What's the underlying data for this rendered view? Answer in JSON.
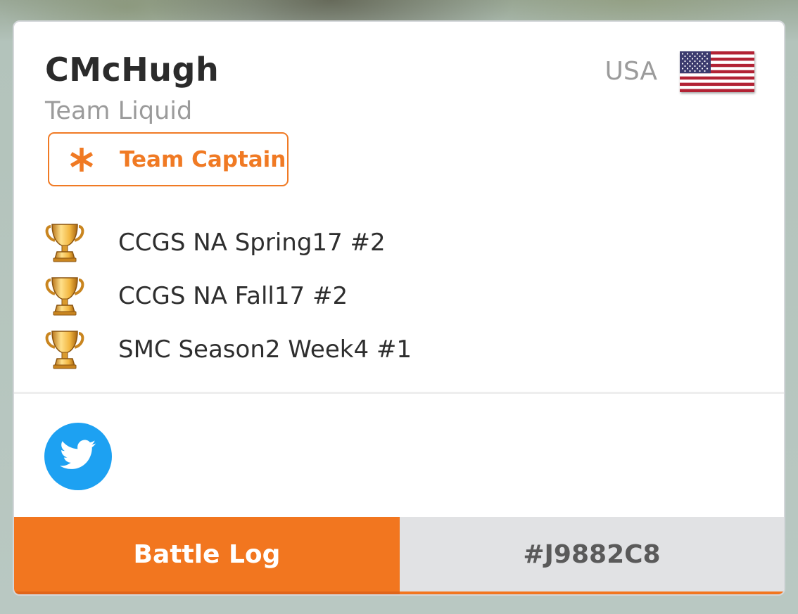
{
  "player": {
    "name": "CMcHugh",
    "team": "Team Liquid",
    "country": "USA",
    "flag_icon": "us-flag-icon"
  },
  "badge": {
    "label": "Team Captain",
    "icon": "asterisk-icon",
    "color": "#f07a24"
  },
  "achievements": [
    {
      "icon": "trophy-icon",
      "label": "CCGS NA Spring17 #2"
    },
    {
      "icon": "trophy-icon",
      "label": "CCGS NA Fall17 #2"
    },
    {
      "icon": "trophy-icon",
      "label": "SMC Season2 Week4 #1"
    }
  ],
  "social": {
    "twitter_icon": "twitter-bird-icon",
    "twitter_color": "#1da1f2"
  },
  "footer": {
    "battle_log_label": "Battle Log",
    "player_tag": "#J9882C8",
    "accent": "#f2761f"
  }
}
